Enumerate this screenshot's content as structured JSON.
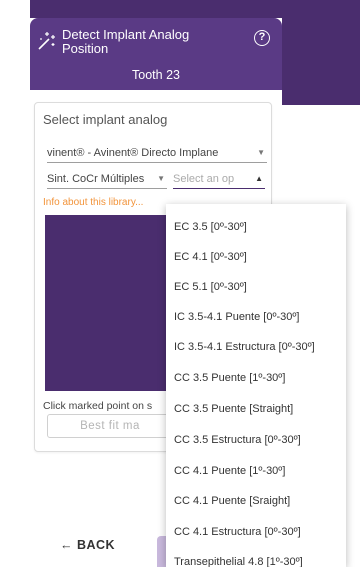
{
  "panel": {
    "title": "Detect Implant Analog Position",
    "tooth": "Tooth 23",
    "help_symbol": "?"
  },
  "card": {
    "title": "Select implant analog",
    "brand_select": {
      "value": "vinent® - Avinent® Directo Implane",
      "arrow": "▼"
    },
    "family_select": {
      "value": "Sint. CoCr Múltiples",
      "arrow": "▼"
    },
    "analog_select": {
      "placeholder": "Select an op",
      "arrow": "▲"
    },
    "info_link": "Info about this library...",
    "hint": "Click marked point on s",
    "best_fit_button": "Best fit ma"
  },
  "footer": {
    "back_label": "← BACK"
  },
  "dropdown": {
    "options": [
      "EC 3.5 [0º-30º]",
      "EC 4.1 [0º-30º]",
      "EC 5.1 [0º-30º]",
      "IC 3.5-4.1 Puente [0º-30º]",
      "IC 3.5-4.1 Estructura [0º-30º]",
      "CC 3.5 Puente [1º-30º]",
      "CC 3.5 Puente [Straight]",
      "CC 3.5 Estructura [0º-30º]",
      "CC 4.1 Puente [1º-30º]",
      "CC 4.1 Puente [Sraight]",
      "CC 4.1 Estructura [0º-30º]",
      "Transepithelial 4.8 [1º-30º]"
    ]
  },
  "colors": {
    "primary": "#5a3a85",
    "background_purple": "#4a2d6e",
    "info_link": "#f2943b"
  }
}
